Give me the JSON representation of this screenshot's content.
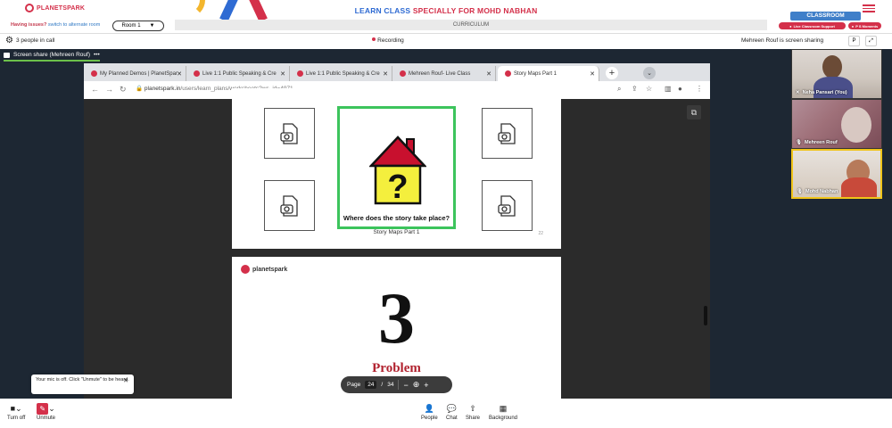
{
  "header": {
    "logo_text": "PLANETSPARK",
    "title_part1": "LEARN CLASS",
    "title_part2": "SPECIALLY FOR MOHD NABHAN",
    "issues_text": "Having issues?",
    "issues_link": "switch to alternate room",
    "room_label": "Room 1",
    "room_caret": "▼",
    "curriculum_label": "CURRICULUM",
    "classroom_label": "CLASSROOM",
    "support_label": "Live Classroom Support",
    "moments_label": "P S Moments"
  },
  "callbar": {
    "people_count": "3 people in call",
    "recording": "Recording",
    "sharing_status": "Mehreen Rouf is screen sharing",
    "p_button": "P"
  },
  "share_tab": {
    "label": "Screen share (Mehreen Rouf)",
    "more": "•••"
  },
  "browser": {
    "tabs": [
      {
        "label": "My Planned Demos | PlanetSpar"
      },
      {
        "label": "Live 1:1 Public Speaking & Cre"
      },
      {
        "label": "Live 1:1 Public Speaking & Cre"
      },
      {
        "label": "Mehreen Rouf- Live Class"
      },
      {
        "label": "Story Maps Part 1"
      }
    ],
    "new_tab": "+",
    "url_host": "planetspark.in",
    "url_path": "/users/learn_plans/worksheets?ws_id=4971"
  },
  "viewer": {
    "page1_question": "Where does the story take place?",
    "page1_label": "Story Maps Part 1",
    "page1_num": "22",
    "page2_logo": "planetspark",
    "page2_number": "3",
    "page2_heading": "Problem",
    "toolbar": {
      "page_label": "Page",
      "current_page": "24",
      "separator": "/",
      "total_pages": "34",
      "zoom_out": "−",
      "zoom_in": "+"
    }
  },
  "participants": [
    {
      "name": "Neha Pansari (You)"
    },
    {
      "name": "Mehreen Rouf"
    },
    {
      "name": "Mohd Nabhan"
    }
  ],
  "mic_tip": {
    "text": "Your mic is off. Click \"Unmute\" to be heard.",
    "close": "✕"
  },
  "bottombar": {
    "turn_off": "Turn off",
    "unmute": "Unmute",
    "people": "People",
    "chat": "Chat",
    "share": "Share",
    "background": "Background"
  },
  "colors": {
    "brand_red": "#d4304a",
    "brand_blue": "#2f6bd3",
    "highlight_green": "#3cc45c",
    "speaker_yellow": "#f0c419"
  }
}
